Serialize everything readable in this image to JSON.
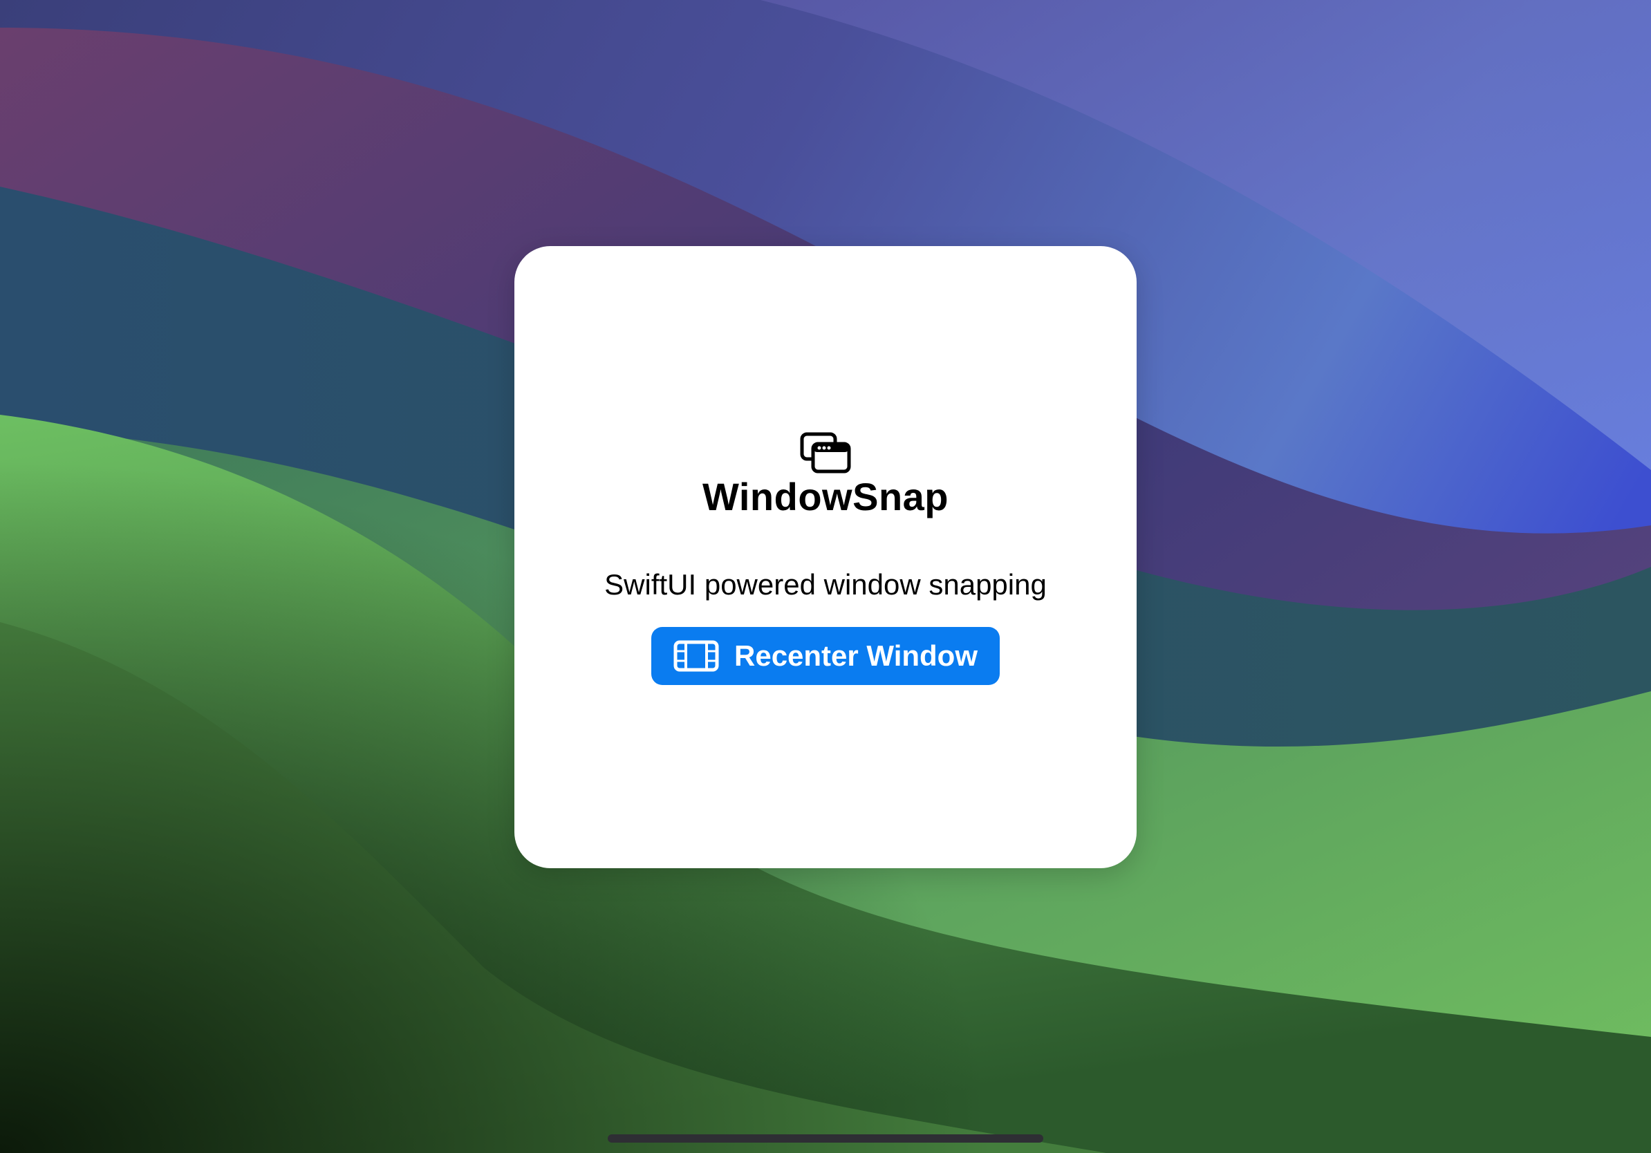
{
  "app": {
    "title": "WindowSnap",
    "icon": "overlapping-windows-icon",
    "subtitle": "SwiftUI powered window snapping"
  },
  "recenter_button": {
    "label": "Recenter Window",
    "icon": "film-strip-icon",
    "color": "#0a7cf0"
  },
  "colors": {
    "card_background": "#ffffff",
    "text": "#000000",
    "button_text": "#ffffff"
  }
}
